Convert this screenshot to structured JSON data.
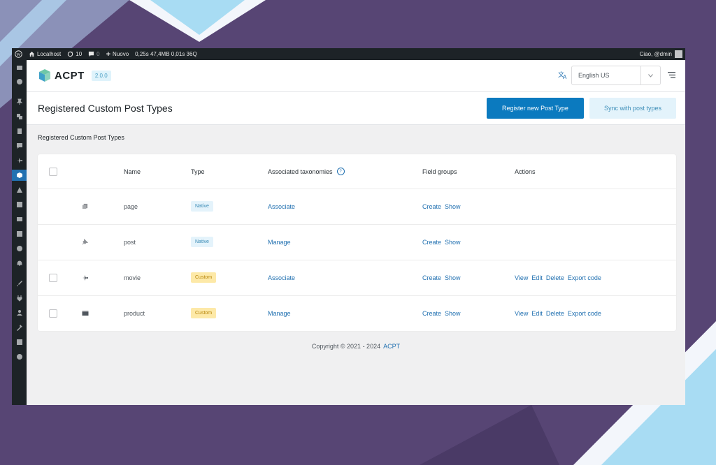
{
  "admin_bar": {
    "site_name": "Localhost",
    "updates_count": "10",
    "comments_count": "0",
    "new_label": "Nuovo",
    "perf_stats": "0,25s 47,4MB 0,01s 36Q",
    "greeting": "Ciao, @dmin"
  },
  "app": {
    "logo_text": "ACPT",
    "version": "2.0.0",
    "language": "English US"
  },
  "header": {
    "title": "Registered Custom Post Types",
    "register_button": "Register new Post Type",
    "sync_button": "Sync with post types"
  },
  "section_title": "Registered Custom Post Types",
  "table": {
    "columns": [
      "Name",
      "Type",
      "Associated taxonomies",
      "Field groups",
      "Actions"
    ],
    "rows": [
      {
        "icon": "page-icon",
        "name": "page",
        "type": "Native",
        "taxonomy_action": "Associate",
        "field_create": "Create",
        "field_show": "Show"
      },
      {
        "icon": "pin-icon",
        "name": "post",
        "type": "Native",
        "taxonomy_action": "Manage",
        "field_create": "Create",
        "field_show": "Show"
      },
      {
        "icon": "airplane-icon",
        "name": "movie",
        "type": "Custom",
        "taxonomy_action": "Associate",
        "field_create": "Create",
        "field_show": "Show",
        "actions": [
          "View",
          "Edit",
          "Delete",
          "Export code"
        ]
      },
      {
        "icon": "box-icon",
        "name": "product",
        "type": "Custom",
        "taxonomy_action": "Manage",
        "field_create": "Create",
        "field_show": "Show",
        "actions": [
          "View",
          "Edit",
          "Delete",
          "Export code"
        ]
      }
    ]
  },
  "footer": {
    "copyright": "Copyright © 2021 - 2024",
    "link": "ACPT"
  },
  "colors": {
    "primary": "#0b7abf",
    "admin_bar": "#1d2327",
    "background": "#574574",
    "native_badge": "#e4f3fb",
    "custom_badge": "#fde9a8"
  }
}
